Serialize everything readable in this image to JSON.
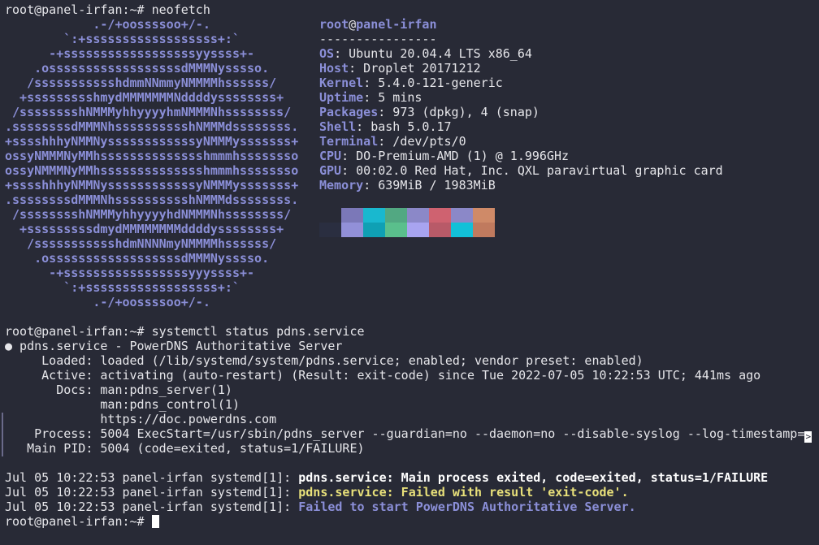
{
  "prompt": "root@panel-irfan:~#",
  "cmd1": "neofetch",
  "logo_lines": [
    "            .-/+oossssoo+/-.",
    "        `:+ssssssssssssssssss+:`",
    "      -+ssssssssssssssssssyyssss+-",
    "    .ossssssssssssssssssdMMMNysssso.",
    "   /ssssssssssshdmmNNmmyNMMMMhssssss/",
    "  +ssssssssshmydMMMMMMMNddddyssssssss+",
    " /sssssssshNMMMyhhyyyyhmNMMMNhssssssss/",
    ".ssssssssdMMMNhsssssssssshNMMMdssssssss.",
    "+sssshhhyNMMNyssssssssssssyNMMMysssssss+",
    "ossyNMMMNyMMhsssssssssssssshmmmhssssssso",
    "ossyNMMMNyMMhsssssssssssssshmmmhssssssso",
    "+sssshhhyNMMNyssssssssssssyNMMMysssssss+",
    ".ssssssssdMMMNhsssssssssshNMMMdssssssss.",
    " /sssssssshNMMMyhhyyyyhdNMMMNhssssssss/",
    "  +sssssssssdmydMMMMMMMMddddyssssssss+",
    "   /ssssssssssshdmNNNNmyNMMMMhssssss/",
    "    .ossssssssssssssssssdMMMNysssso.",
    "      -+sssssssssssssssssyyyssss+-",
    "        `:+ssssssssssssssssss+:`",
    "            .-/+oossssoo+/-."
  ],
  "info": {
    "user": "root",
    "at": "@",
    "host": "panel-irfan",
    "separator": "----------------",
    "fields": [
      {
        "key": "OS",
        "value": ": Ubuntu 20.04.4 LTS x86_64"
      },
      {
        "key": "Host",
        "value": ": Droplet 20171212"
      },
      {
        "key": "Kernel",
        "value": ": 5.4.0-121-generic"
      },
      {
        "key": "Uptime",
        "value": ": 5 mins"
      },
      {
        "key": "Packages",
        "value": ": 973 (dpkg), 4 (snap)"
      },
      {
        "key": "Shell",
        "value": ": bash 5.0.17"
      },
      {
        "key": "Terminal",
        "value": ": /dev/pts/0"
      },
      {
        "key": "CPU",
        "value": ": DO-Premium-AMD (1) @ 1.996GHz"
      },
      {
        "key": "GPU",
        "value": ": 00:02.0 Red Hat, Inc. QXL paravirtual graphic card"
      },
      {
        "key": "Memory",
        "value": ": 639MiB / 1983MiB"
      }
    ]
  },
  "palette": {
    "row1": [
      "#282a36",
      "#7b78b8",
      "#19b8cf",
      "#52a882",
      "#8b88c8",
      "#cf6270",
      "#8b88c8",
      "#cf8a68"
    ],
    "row2": [
      "#2a2e40",
      "#9290d8",
      "#0fa0b4",
      "#5abf8c",
      "#a8a4f0",
      "#b85a68",
      "#12c0d8",
      "#c07a5e"
    ]
  },
  "cmd2": "systemctl status pdns.service",
  "status": {
    "bullet": "●",
    "title": " pdns.service - PowerDNS Authoritative Server",
    "loaded": "     Loaded: loaded (/lib/systemd/system/pdns.service; enabled; vendor preset: enabled)",
    "active": "     Active: activating (auto-restart) (Result: exit-code) since Tue 2022-07-05 10:22:53 UTC; 441ms ago",
    "docs1": "       Docs: man:pdns_server(1)",
    "docs2": "             man:pdns_control(1)",
    "docs3": "             https://doc.powerdns.com",
    "process": "    Process: 5004 ExecStart=/usr/sbin/pdns_server --guardian=no --daemon=no --disable-syslog --log-timestamp=",
    "trunc_mark": ">",
    "mainpid": "   Main PID: 5004 (code=exited, status=1/FAILURE)"
  },
  "log": [
    {
      "prefix": "Jul 05 10:22:53 panel-irfan systemd[1]: ",
      "msg": "pdns.service: Main process exited, code=exited, status=1/FAILURE"
    },
    {
      "prefix": "Jul 05 10:22:53 panel-irfan systemd[1]: ",
      "msg": "pdns.service: Failed with result 'exit-code'."
    },
    {
      "prefix": "Jul 05 10:22:53 panel-irfan systemd[1]: ",
      "msg": "Failed to start PowerDNS Authoritative Server."
    }
  ]
}
